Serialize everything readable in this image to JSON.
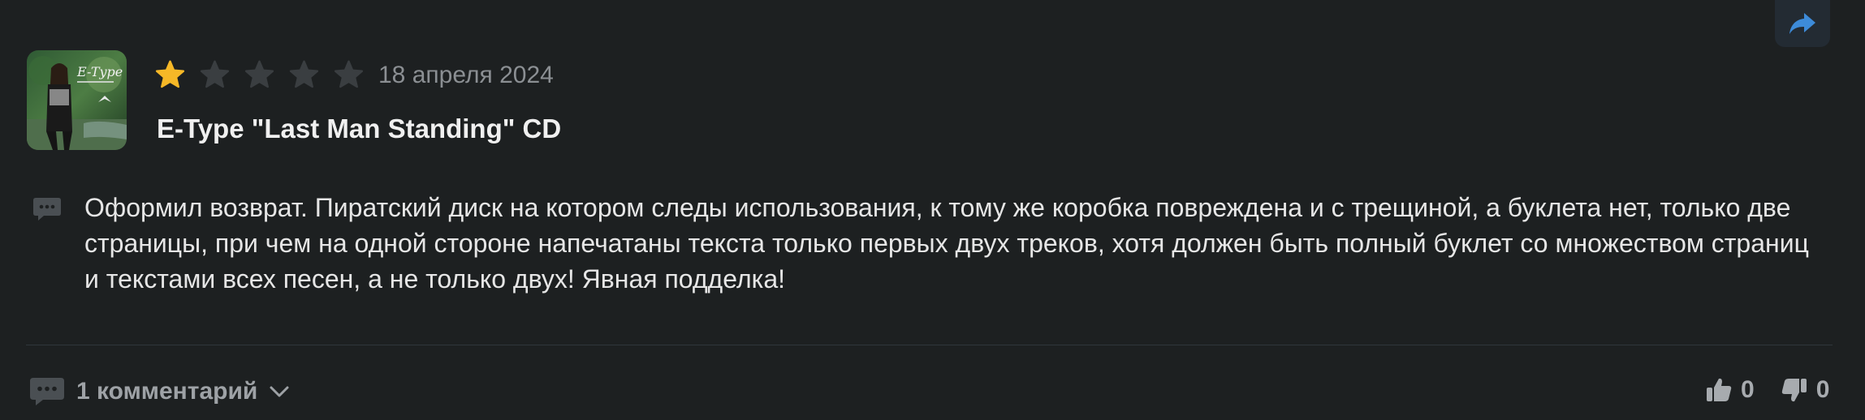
{
  "review": {
    "rating": 1,
    "max_rating": 5,
    "date": "18 апреля 2024",
    "product_title": "E-Type \"Last Man Standing\" CD",
    "text": "Оформил возврат. Пиратский диск на котором следы использования, к тому же коробка повреждена и с трещиной, а буклета нет, только две страницы, при чем на одной стороне напечатаны текста только первых двух треков, хотя должен быть полный буклет со множеством страниц и текстами всех песен, а не только двух! Явная подделка!",
    "cover_text": "E-Type"
  },
  "footer": {
    "comments_label": "1 комментарий",
    "likes": "0",
    "dislikes": "0"
  },
  "colors": {
    "background": "#1d2021",
    "star_active": "#f6b827",
    "star_inactive": "#3a3e41",
    "accent": "#3d8bd9"
  },
  "icons": {
    "share": "share-arrow-icon",
    "message": "message-bubble-icon",
    "comments": "comment-bubble-icon",
    "expand": "chevron-down-icon",
    "like": "thumbs-up-icon",
    "dislike": "thumbs-down-icon"
  }
}
